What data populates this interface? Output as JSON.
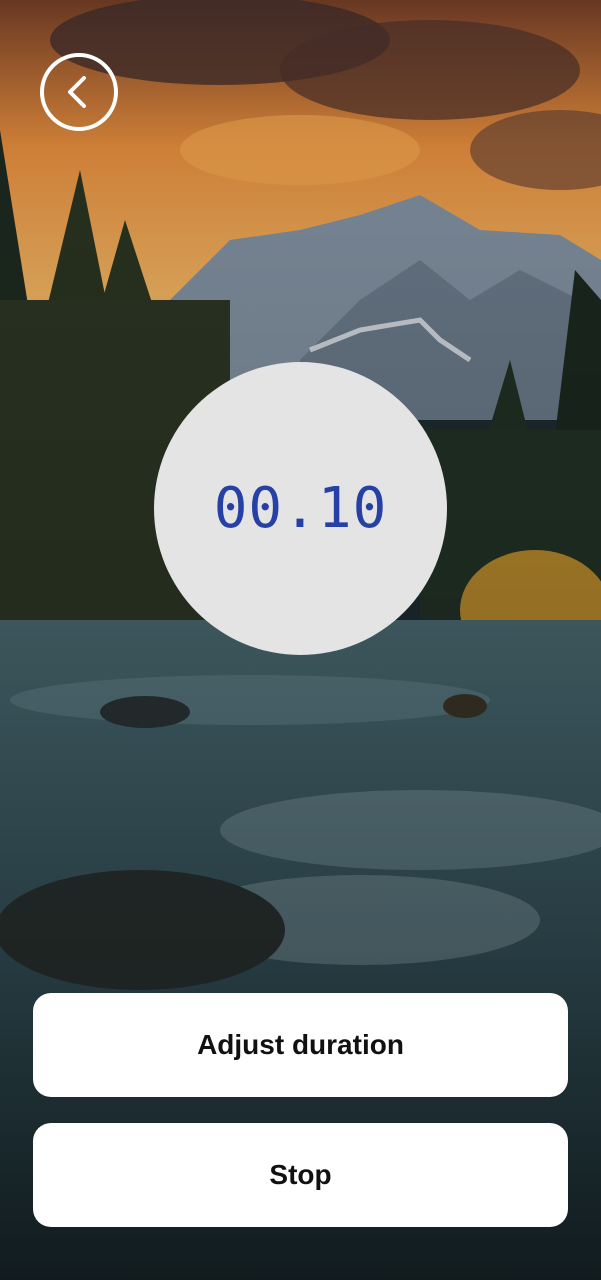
{
  "timer": {
    "display": "00.10"
  },
  "actions": {
    "adjust_label": "Adjust duration",
    "stop_label": "Stop"
  },
  "icons": {
    "back": "chevron-left-icon"
  },
  "colors": {
    "timer_text": "#2740a6",
    "timer_bg": "#e4e4e4",
    "button_bg": "#ffffff"
  }
}
